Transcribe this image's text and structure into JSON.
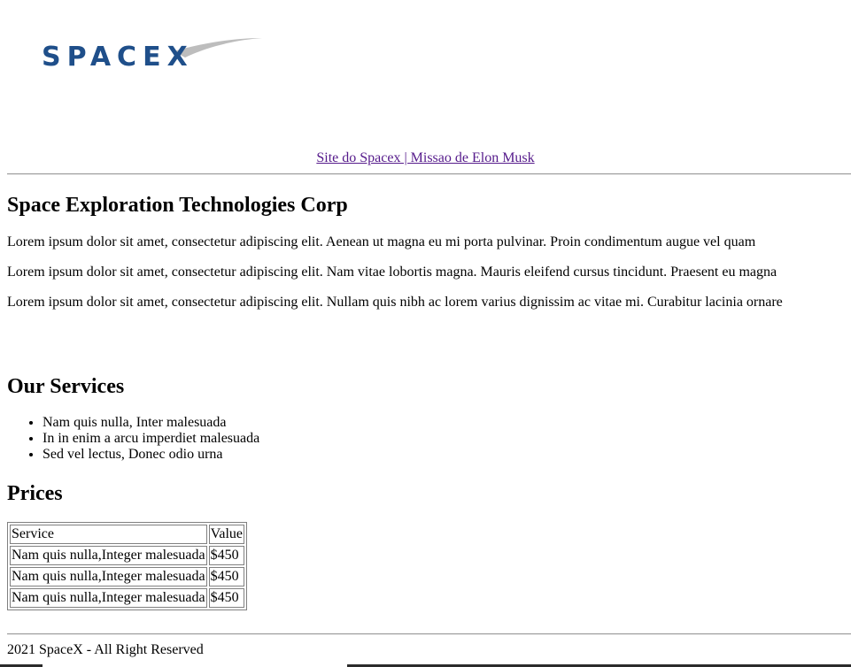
{
  "header": {
    "logo_text": "SPACEX",
    "nav_link_text": "Site do Spacex | Missao de Elon Musk"
  },
  "about": {
    "title": "Space Exploration Technologies Corp",
    "paragraphs": [
      "Lorem ipsum dolor sit amet, consectetur adipiscing elit. Aenean ut magna eu mi porta pulvinar. Proin condimentum augue vel quam",
      "Lorem ipsum dolor sit amet, consectetur adipiscing elit. Nam vitae lobortis magna. Mauris eleifend cursus tincidunt. Praesent eu magna",
      "Lorem ipsum dolor sit amet, consectetur adipiscing elit. Nullam quis nibh ac lorem varius dignissim ac vitae mi. Curabitur lacinia ornare"
    ]
  },
  "services": {
    "title": "Our Services",
    "items": [
      "Nam quis nulla, Inter malesuada",
      "In in enim a arcu imperdiet malesuada",
      "Sed vel lectus, Donec odio urna"
    ]
  },
  "prices": {
    "title": "Prices",
    "headers": [
      "Service",
      "Value"
    ],
    "rows": [
      [
        "Nam quis nulla,Integer malesuada",
        "$450"
      ],
      [
        "Nam quis nulla,Integer malesuada",
        "$450"
      ],
      [
        "Nam quis nulla,Integer malesuada",
        "$450"
      ]
    ]
  },
  "footer": {
    "text": "2021 SpaceX - All Right Reserved"
  },
  "colors": {
    "logo_blue": "#1f4f8a",
    "logo_swoosh": "#b9b9b9",
    "link_visited": "#551a8b"
  }
}
